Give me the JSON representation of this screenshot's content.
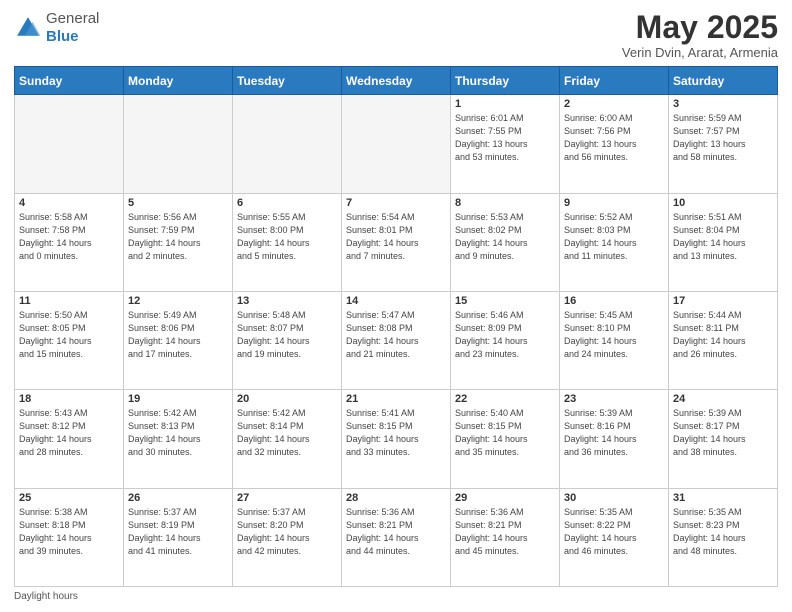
{
  "header": {
    "logo_general": "General",
    "logo_blue": "Blue",
    "month_title": "May 2025",
    "subtitle": "Verin Dvin, Ararat, Armenia"
  },
  "days_of_week": [
    "Sunday",
    "Monday",
    "Tuesday",
    "Wednesday",
    "Thursday",
    "Friday",
    "Saturday"
  ],
  "footer": {
    "daylight_label": "Daylight hours"
  },
  "weeks": [
    [
      {
        "day": "",
        "info": ""
      },
      {
        "day": "",
        "info": ""
      },
      {
        "day": "",
        "info": ""
      },
      {
        "day": "",
        "info": ""
      },
      {
        "day": "1",
        "info": "Sunrise: 6:01 AM\nSunset: 7:55 PM\nDaylight: 13 hours\nand 53 minutes."
      },
      {
        "day": "2",
        "info": "Sunrise: 6:00 AM\nSunset: 7:56 PM\nDaylight: 13 hours\nand 56 minutes."
      },
      {
        "day": "3",
        "info": "Sunrise: 5:59 AM\nSunset: 7:57 PM\nDaylight: 13 hours\nand 58 minutes."
      }
    ],
    [
      {
        "day": "4",
        "info": "Sunrise: 5:58 AM\nSunset: 7:58 PM\nDaylight: 14 hours\nand 0 minutes."
      },
      {
        "day": "5",
        "info": "Sunrise: 5:56 AM\nSunset: 7:59 PM\nDaylight: 14 hours\nand 2 minutes."
      },
      {
        "day": "6",
        "info": "Sunrise: 5:55 AM\nSunset: 8:00 PM\nDaylight: 14 hours\nand 5 minutes."
      },
      {
        "day": "7",
        "info": "Sunrise: 5:54 AM\nSunset: 8:01 PM\nDaylight: 14 hours\nand 7 minutes."
      },
      {
        "day": "8",
        "info": "Sunrise: 5:53 AM\nSunset: 8:02 PM\nDaylight: 14 hours\nand 9 minutes."
      },
      {
        "day": "9",
        "info": "Sunrise: 5:52 AM\nSunset: 8:03 PM\nDaylight: 14 hours\nand 11 minutes."
      },
      {
        "day": "10",
        "info": "Sunrise: 5:51 AM\nSunset: 8:04 PM\nDaylight: 14 hours\nand 13 minutes."
      }
    ],
    [
      {
        "day": "11",
        "info": "Sunrise: 5:50 AM\nSunset: 8:05 PM\nDaylight: 14 hours\nand 15 minutes."
      },
      {
        "day": "12",
        "info": "Sunrise: 5:49 AM\nSunset: 8:06 PM\nDaylight: 14 hours\nand 17 minutes."
      },
      {
        "day": "13",
        "info": "Sunrise: 5:48 AM\nSunset: 8:07 PM\nDaylight: 14 hours\nand 19 minutes."
      },
      {
        "day": "14",
        "info": "Sunrise: 5:47 AM\nSunset: 8:08 PM\nDaylight: 14 hours\nand 21 minutes."
      },
      {
        "day": "15",
        "info": "Sunrise: 5:46 AM\nSunset: 8:09 PM\nDaylight: 14 hours\nand 23 minutes."
      },
      {
        "day": "16",
        "info": "Sunrise: 5:45 AM\nSunset: 8:10 PM\nDaylight: 14 hours\nand 24 minutes."
      },
      {
        "day": "17",
        "info": "Sunrise: 5:44 AM\nSunset: 8:11 PM\nDaylight: 14 hours\nand 26 minutes."
      }
    ],
    [
      {
        "day": "18",
        "info": "Sunrise: 5:43 AM\nSunset: 8:12 PM\nDaylight: 14 hours\nand 28 minutes."
      },
      {
        "day": "19",
        "info": "Sunrise: 5:42 AM\nSunset: 8:13 PM\nDaylight: 14 hours\nand 30 minutes."
      },
      {
        "day": "20",
        "info": "Sunrise: 5:42 AM\nSunset: 8:14 PM\nDaylight: 14 hours\nand 32 minutes."
      },
      {
        "day": "21",
        "info": "Sunrise: 5:41 AM\nSunset: 8:15 PM\nDaylight: 14 hours\nand 33 minutes."
      },
      {
        "day": "22",
        "info": "Sunrise: 5:40 AM\nSunset: 8:15 PM\nDaylight: 14 hours\nand 35 minutes."
      },
      {
        "day": "23",
        "info": "Sunrise: 5:39 AM\nSunset: 8:16 PM\nDaylight: 14 hours\nand 36 minutes."
      },
      {
        "day": "24",
        "info": "Sunrise: 5:39 AM\nSunset: 8:17 PM\nDaylight: 14 hours\nand 38 minutes."
      }
    ],
    [
      {
        "day": "25",
        "info": "Sunrise: 5:38 AM\nSunset: 8:18 PM\nDaylight: 14 hours\nand 39 minutes."
      },
      {
        "day": "26",
        "info": "Sunrise: 5:37 AM\nSunset: 8:19 PM\nDaylight: 14 hours\nand 41 minutes."
      },
      {
        "day": "27",
        "info": "Sunrise: 5:37 AM\nSunset: 8:20 PM\nDaylight: 14 hours\nand 42 minutes."
      },
      {
        "day": "28",
        "info": "Sunrise: 5:36 AM\nSunset: 8:21 PM\nDaylight: 14 hours\nand 44 minutes."
      },
      {
        "day": "29",
        "info": "Sunrise: 5:36 AM\nSunset: 8:21 PM\nDaylight: 14 hours\nand 45 minutes."
      },
      {
        "day": "30",
        "info": "Sunrise: 5:35 AM\nSunset: 8:22 PM\nDaylight: 14 hours\nand 46 minutes."
      },
      {
        "day": "31",
        "info": "Sunrise: 5:35 AM\nSunset: 8:23 PM\nDaylight: 14 hours\nand 48 minutes."
      }
    ]
  ]
}
